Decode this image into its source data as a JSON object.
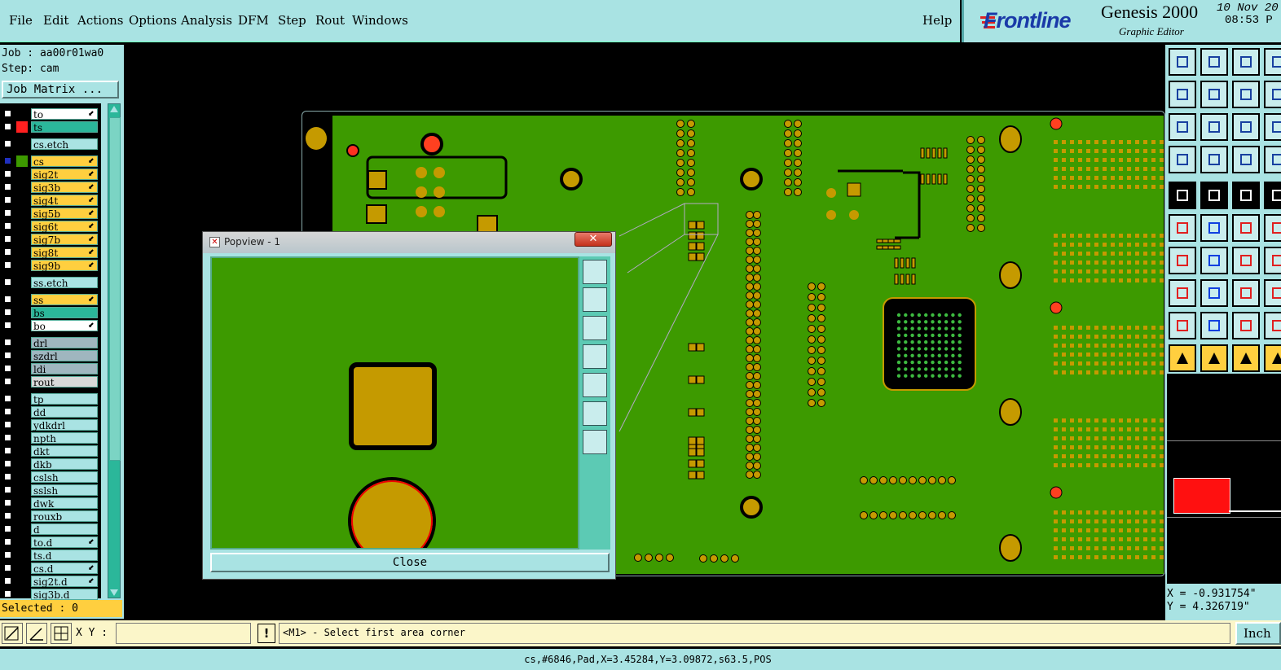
{
  "menu": {
    "file": "File",
    "edit": "Edit",
    "actions": "Actions",
    "options": "Options",
    "analysis": "Analysis",
    "dfm": "DFM",
    "step": "Step",
    "rout": "Rout",
    "windows": "Windows",
    "help": "Help"
  },
  "brand": {
    "logo": "Frontline",
    "product": "Genesis 2000",
    "subtitle": "Graphic Editor",
    "date": "10 Nov 20",
    "time": "08:53 P"
  },
  "job": {
    "job_label": "Job : aa00r01wa0",
    "step_label": "Step: cam",
    "matrix_button": "Job Matrix ..."
  },
  "layers": [
    {
      "name": "to",
      "bg": "#ffffff",
      "color_swatch": "",
      "arrow": true
    },
    {
      "name": "ts",
      "bg": "#2bb79a",
      "color_swatch": "#ff2020",
      "arrow": false
    },
    {
      "name": "cs.etch",
      "bg": "#a9e3e3",
      "color_swatch": "",
      "arrow": false,
      "sep_before": true
    },
    {
      "name": "cs",
      "bg": "#ffcf3f",
      "color_swatch": "#3d9a00",
      "arrow": true,
      "sep_before": true,
      "checked_blue": true
    },
    {
      "name": "sig2t",
      "bg": "#ffcf3f",
      "color_swatch": "",
      "arrow": true
    },
    {
      "name": "sig3b",
      "bg": "#ffcf3f",
      "color_swatch": "",
      "arrow": true
    },
    {
      "name": "sig4t",
      "bg": "#ffcf3f",
      "color_swatch": "",
      "arrow": true
    },
    {
      "name": "sig5b",
      "bg": "#ffcf3f",
      "color_swatch": "",
      "arrow": true
    },
    {
      "name": "sig6t",
      "bg": "#ffcf3f",
      "color_swatch": "",
      "arrow": true
    },
    {
      "name": "sig7b",
      "bg": "#ffcf3f",
      "color_swatch": "",
      "arrow": true
    },
    {
      "name": "sig8t",
      "bg": "#ffcf3f",
      "color_swatch": "",
      "arrow": true
    },
    {
      "name": "sig9b",
      "bg": "#ffcf3f",
      "color_swatch": "",
      "arrow": true
    },
    {
      "name": "ss.etch",
      "bg": "#a9e3e3",
      "color_swatch": "",
      "arrow": false,
      "sep_before": true
    },
    {
      "name": "ss",
      "bg": "#ffcf3f",
      "color_swatch": "",
      "arrow": true,
      "sep_before": true
    },
    {
      "name": "bs",
      "bg": "#2bb79a",
      "color_swatch": "",
      "arrow": false
    },
    {
      "name": "bo",
      "bg": "#ffffff",
      "color_swatch": "",
      "arrow": true
    },
    {
      "name": "drl",
      "bg": "#9fb6bf",
      "color_swatch": "",
      "arrow": false,
      "sep_before": true
    },
    {
      "name": "szdrl",
      "bg": "#9fb6bf",
      "color_swatch": "",
      "arrow": false
    },
    {
      "name": "ldi",
      "bg": "#9fb6bf",
      "color_swatch": "",
      "arrow": false
    },
    {
      "name": "rout",
      "bg": "#d8d8d8",
      "color_swatch": "",
      "arrow": false
    },
    {
      "name": "tp",
      "bg": "#a9e3e3",
      "color_swatch": "",
      "arrow": false,
      "sep_before": true
    },
    {
      "name": "dd",
      "bg": "#a9e3e3",
      "color_swatch": "",
      "arrow": false
    },
    {
      "name": "ydkdrl",
      "bg": "#a9e3e3",
      "color_swatch": "",
      "arrow": false
    },
    {
      "name": "npth",
      "bg": "#a9e3e3",
      "color_swatch": "",
      "arrow": false
    },
    {
      "name": "dkt",
      "bg": "#a9e3e3",
      "color_swatch": "",
      "arrow": false
    },
    {
      "name": "dkb",
      "bg": "#a9e3e3",
      "color_swatch": "",
      "arrow": false
    },
    {
      "name": "cslsh",
      "bg": "#a9e3e3",
      "color_swatch": "",
      "arrow": false
    },
    {
      "name": "sslsh",
      "bg": "#a9e3e3",
      "color_swatch": "",
      "arrow": false
    },
    {
      "name": "dwk",
      "bg": "#a9e3e3",
      "color_swatch": "",
      "arrow": false
    },
    {
      "name": "rouxb",
      "bg": "#a9e3e3",
      "color_swatch": "",
      "arrow": false
    },
    {
      "name": "d",
      "bg": "#a9e3e3",
      "color_swatch": "",
      "arrow": false
    },
    {
      "name": "to.d",
      "bg": "#a9e3e3",
      "color_swatch": "",
      "arrow": true
    },
    {
      "name": "ts.d",
      "bg": "#a9e3e3",
      "color_swatch": "",
      "arrow": false
    },
    {
      "name": "cs.d",
      "bg": "#a9e3e3",
      "color_swatch": "",
      "arrow": true
    },
    {
      "name": "sig2t.d",
      "bg": "#a9e3e3",
      "color_swatch": "",
      "arrow": true
    },
    {
      "name": "sig3b.d",
      "bg": "#a9e3e3",
      "color_swatch": "",
      "arrow": false
    }
  ],
  "selected_label": "Selected : 0",
  "popview": {
    "title": "Popview - 1",
    "close_button": "Close"
  },
  "coords": {
    "x": "X = -0.931754\"",
    "y": "Y = 4.326719\""
  },
  "command": {
    "xy_label": "X Y :",
    "xy_value": "",
    "warn_icon": "!",
    "prompt": "<M1> - Select first area corner",
    "units_button": "Inch"
  },
  "status": "cs,#6846,Pad,X=3.45284,Y=3.09872,s63.5,POS",
  "colors": {
    "panel": "#a9e3e3",
    "board": "#3d9a00",
    "pad": "#c59a00",
    "selected_layer": "#ffcf3f",
    "highlight": "#ff2020"
  }
}
